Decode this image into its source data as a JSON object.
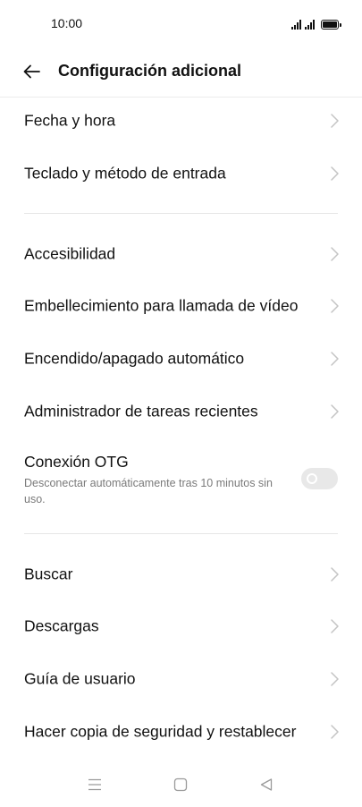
{
  "status_bar": {
    "time": "10:00",
    "icons": [
      "signal-sim1-icon",
      "signal-sim2-icon",
      "battery-icon"
    ]
  },
  "header": {
    "title": "Configuración adicional",
    "back_icon": "arrow-left-icon"
  },
  "sections": [
    {
      "items": [
        {
          "label": "Fecha y hora"
        },
        {
          "label": "Teclado y método de entrada"
        }
      ]
    },
    {
      "items": [
        {
          "label": "Accesibilidad"
        },
        {
          "label": "Embellecimiento para llamada de vídeo"
        },
        {
          "label": "Encendido/apagado automático"
        },
        {
          "label": "Administrador de tareas recientes"
        }
      ],
      "toggle_item": {
        "label": "Conexión OTG",
        "description": "Desconectar automáticamente tras 10 minutos sin uso.",
        "enabled": false
      }
    },
    {
      "items": [
        {
          "label": "Buscar"
        },
        {
          "label": "Descargas"
        },
        {
          "label": "Guía de usuario"
        },
        {
          "label": "Hacer copia de seguridad y restablecer"
        }
      ]
    }
  ],
  "navigation_bar": {
    "icons": [
      "menu-icon",
      "home-icon",
      "back-triangle-icon"
    ]
  },
  "colors": {
    "text": "#111111",
    "secondary_text": "#7a7a7a",
    "chevron": "#c4c4c4",
    "divider": "#e6e6e6",
    "toggle_off": "#e8e8e8"
  }
}
